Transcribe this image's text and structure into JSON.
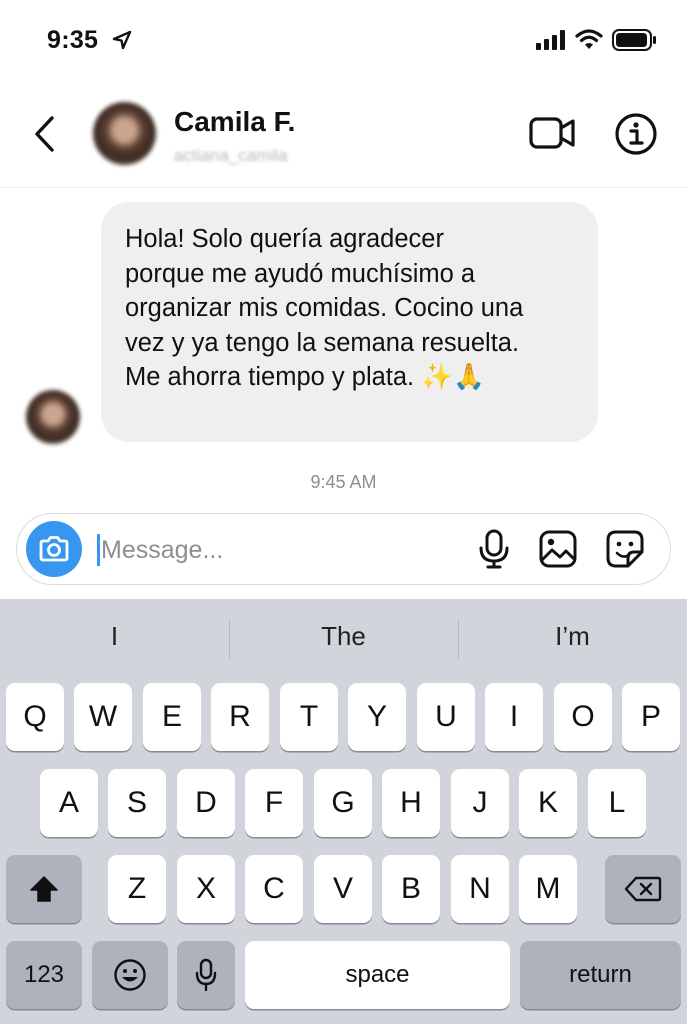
{
  "status_bar": {
    "time": "9:35",
    "icons": [
      "location-arrow-icon",
      "cellular-signal-icon",
      "wifi-icon",
      "battery-icon"
    ]
  },
  "header": {
    "contact_name": "Camila F.",
    "contact_username": "actiana_camila",
    "icons": [
      "back-chevron-icon",
      "video-call-icon",
      "info-icon"
    ]
  },
  "chat": {
    "message": "Hola! Solo quería agradecer\nporque me ayudó muchísimo a\norganizar mis comidas. Cocino una\nvez y ya tengo la semana resuelta.\nMe ahorra tiempo y plata. ✨🙏",
    "timestamp": "9:45 AM"
  },
  "composer": {
    "placeholder": "Message...",
    "accent_color": "#3797f0",
    "icons": [
      "camera-icon",
      "microphone-icon",
      "gallery-icon",
      "sticker-icon"
    ]
  },
  "keyboard": {
    "suggestions": [
      "I",
      "The",
      "I’m"
    ],
    "row1": [
      "Q",
      "W",
      "E",
      "R",
      "T",
      "Y",
      "U",
      "I",
      "O",
      "P"
    ],
    "row2": [
      "A",
      "S",
      "D",
      "F",
      "G",
      "H",
      "J",
      "K",
      "L"
    ],
    "row3": [
      "Z",
      "X",
      "C",
      "V",
      "B",
      "N",
      "M"
    ],
    "numbers_label": "123",
    "space_label": "space",
    "return_label": "return",
    "icons": [
      "shift-icon",
      "delete-icon",
      "emoji-icon",
      "dictation-mic-icon"
    ]
  }
}
